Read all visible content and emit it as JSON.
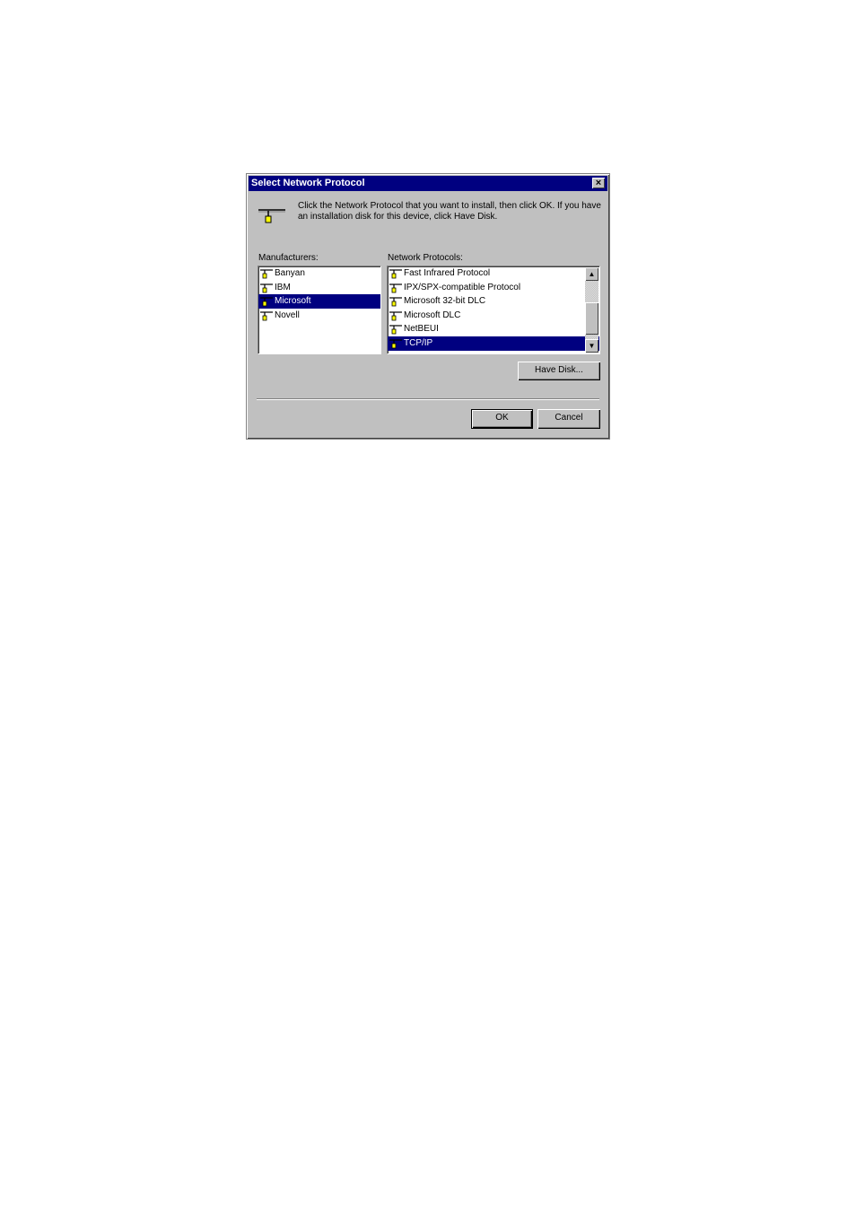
{
  "dialog": {
    "title": "Select Network Protocol",
    "close_label": "×",
    "description": "Click the Network Protocol that you want to install, then click OK. If you have an installation disk for this device, click Have Disk."
  },
  "manufacturers": {
    "label": "Manufacturers:",
    "items": [
      "Banyan",
      "IBM",
      "Microsoft",
      "Novell"
    ],
    "selected": "Microsoft"
  },
  "protocols": {
    "label": "Network Protocols:",
    "items": [
      "Fast Infrared Protocol",
      "IPX/SPX-compatible Protocol",
      "Microsoft 32-bit DLC",
      "Microsoft DLC",
      "NetBEUI",
      "TCP/IP"
    ],
    "selected": "TCP/IP"
  },
  "buttons": {
    "have_disk": "Have Disk...",
    "ok": "OK",
    "cancel": "Cancel"
  },
  "icons": {
    "protocol": "network-protocol-icon",
    "scroll_up": "▲",
    "scroll_down": "▼"
  },
  "colors": {
    "selection": "#000080",
    "face": "#c0c0c0"
  }
}
